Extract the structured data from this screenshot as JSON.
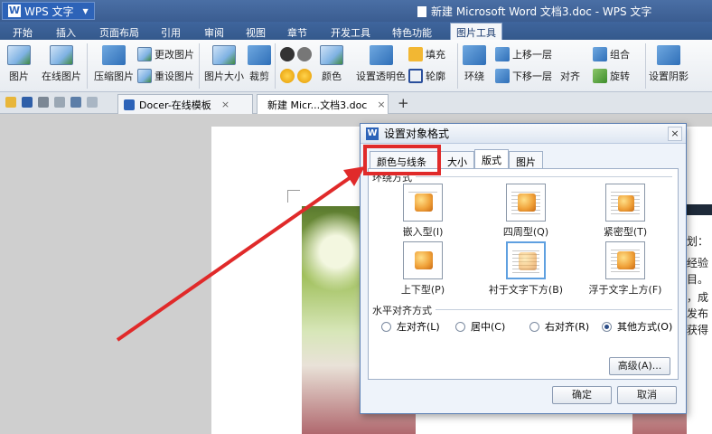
{
  "titlebar": {
    "app_name": "WPS 文字",
    "logo": "W",
    "window_title": "新建 Microsoft Word 文档3.doc - WPS 文字"
  },
  "menu": {
    "tabs": [
      "开始",
      "插入",
      "页面布局",
      "引用",
      "审阅",
      "视图",
      "章节",
      "开发工具",
      "特色功能",
      "图片工具"
    ],
    "active": "图片工具"
  },
  "ribbon": {
    "picture": "图片",
    "online_picture": "在线图片",
    "compress": "压缩图片",
    "change_picture": "更改图片",
    "reset_picture": "重设图片",
    "picture_size": "图片大小",
    "crop": "裁剪",
    "color": "颜色",
    "set_transparent": "设置透明色",
    "fill": "填充",
    "outline": "轮廓",
    "surround": "环绕",
    "bring_forward": "上移一层",
    "send_backward": "下移一层",
    "align": "对齐",
    "group": "组合",
    "rotate": "旋转",
    "shadow": "设置阴影"
  },
  "tabstrip": {
    "docer_tab": "Docer-在线模板",
    "doc_tab": "新建 Micr...文档3.doc",
    "close_glyph": "×",
    "plus_glyph": "+"
  },
  "document": {
    "side_lines": [
      "划：",
      "经验",
      "目。",
      "，成",
      "发布",
      "获得"
    ]
  },
  "dialog": {
    "title": "设置对象格式",
    "logo": "W",
    "close_glyph": "×",
    "tabs": [
      "颜色与线条",
      "大小",
      "版式",
      "图片"
    ],
    "active_tab": "版式",
    "wrap_group_label": "环绕方式",
    "wrap_options": [
      {
        "label": "嵌入型(I)",
        "style": "inline",
        "selected": false
      },
      {
        "label": "四周型(Q)",
        "style": "square",
        "selected": false
      },
      {
        "label": "紧密型(T)",
        "style": "tight",
        "selected": false
      },
      {
        "label": "上下型(P)",
        "style": "topbottom",
        "selected": false
      },
      {
        "label": "衬于文字下方(B)",
        "style": "behind",
        "selected": true
      },
      {
        "label": "浮于文字上方(F)",
        "style": "front",
        "selected": false
      }
    ],
    "halign_group_label": "水平对齐方式",
    "halign_options": [
      {
        "label": "左对齐(L)",
        "checked": false
      },
      {
        "label": "居中(C)",
        "checked": false
      },
      {
        "label": "右对齐(R)",
        "checked": false
      },
      {
        "label": "其他方式(O)",
        "checked": true
      }
    ],
    "advanced_button": "高级(A)...",
    "ok_button": "确定",
    "cancel_button": "取消"
  },
  "annotation": {
    "highlight_color": "#e02a2a"
  }
}
